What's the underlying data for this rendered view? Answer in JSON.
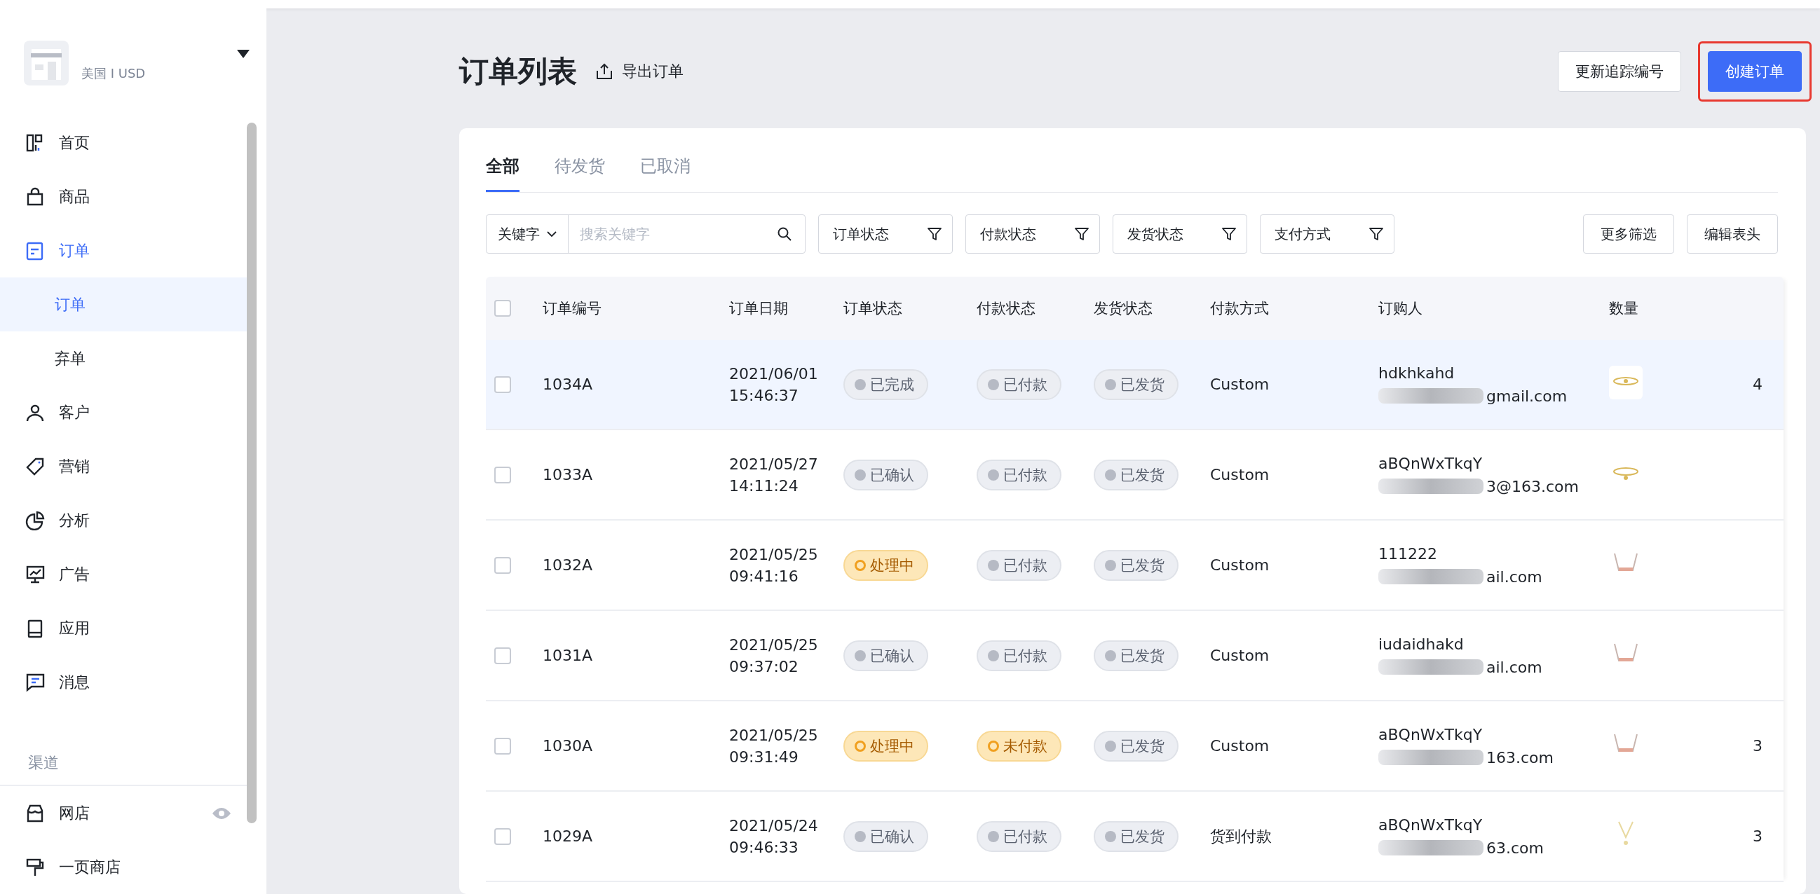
{
  "store": {
    "region": "美国 I USD"
  },
  "sidebar": {
    "items": [
      {
        "label": "首页",
        "selected": false
      },
      {
        "label": "商品",
        "selected": false
      },
      {
        "label": "订单",
        "selected": true,
        "children": [
          {
            "label": "订单",
            "selected": true
          },
          {
            "label": "弃单",
            "selected": false
          }
        ]
      },
      {
        "label": "客户",
        "selected": false
      },
      {
        "label": "营销",
        "selected": false
      },
      {
        "label": "分析",
        "selected": false
      },
      {
        "label": "广告",
        "selected": false
      },
      {
        "label": "应用",
        "selected": false
      },
      {
        "label": "消息",
        "selected": false
      }
    ],
    "section": "渠道",
    "channels": [
      {
        "label": "网店",
        "kind": "visible"
      },
      {
        "label": "一页商店",
        "kind": "plain"
      }
    ]
  },
  "header": {
    "title": "订单列表",
    "export": "导出订单",
    "buttons": [
      {
        "label": "更新追踪编号",
        "kind": "secondary"
      },
      {
        "label": "创建订单",
        "kind": "primary"
      }
    ]
  },
  "tabs": [
    {
      "label": "全部",
      "selected": true
    },
    {
      "label": "待发货",
      "selected": false
    },
    {
      "label": "已取消",
      "selected": false
    }
  ],
  "filters": {
    "keyword_select": "关键字",
    "search": {
      "placeholder": "搜索关键字"
    },
    "dropdowns": [
      "订单状态",
      "付款状态",
      "发货状态",
      "支付方式"
    ],
    "buttons": [
      "更多筛选",
      "编辑表头"
    ]
  },
  "table": {
    "all_checked": false,
    "columns": [
      "订单编号",
      "订单日期",
      "订单状态",
      "付款状态",
      "发货状态",
      "付款方式",
      "订购人",
      "数量"
    ],
    "rows": [
      {
        "selected": true,
        "checked": false,
        "id": "1034A",
        "date": "2021/06/01",
        "time": "15:46:37",
        "order_status": {
          "label": "已完成",
          "kind": "neutral"
        },
        "payment_status": {
          "label": "已付款",
          "kind": "neutral"
        },
        "shipping_status": {
          "label": "已发货",
          "kind": "neutral"
        },
        "method": "Custom",
        "buyer": "hdkhkahd",
        "email": "gmail.com",
        "quantity": "4"
      },
      {
        "selected": false,
        "checked": false,
        "id": "1033A",
        "date": "2021/05/27",
        "time": "14:11:24",
        "order_status": {
          "label": "已确认",
          "kind": "neutral"
        },
        "payment_status": {
          "label": "已付款",
          "kind": "neutral"
        },
        "shipping_status": {
          "label": "已发货",
          "kind": "neutral"
        },
        "method": "Custom",
        "buyer": "aBQnWxTkqY",
        "email": "3@163.com"
      },
      {
        "selected": false,
        "checked": false,
        "id": "1032A",
        "date": "2021/05/25",
        "time": "09:41:16",
        "order_status": {
          "label": "处理中",
          "kind": "warning"
        },
        "payment_status": {
          "label": "已付款",
          "kind": "neutral"
        },
        "shipping_status": {
          "label": "已发货",
          "kind": "neutral"
        },
        "method": "Custom",
        "buyer": "111222",
        "email": "ail.com"
      },
      {
        "selected": false,
        "checked": false,
        "id": "1031A",
        "date": "2021/05/25",
        "time": "09:37:02",
        "order_status": {
          "label": "已确认",
          "kind": "neutral"
        },
        "payment_status": {
          "label": "已付款",
          "kind": "neutral"
        },
        "shipping_status": {
          "label": "已发货",
          "kind": "neutral"
        },
        "method": "Custom",
        "buyer": "iudaidhakd",
        "email": "ail.com"
      },
      {
        "selected": false,
        "checked": false,
        "id": "1030A",
        "date": "2021/05/25",
        "time": "09:31:49",
        "order_status": {
          "label": "处理中",
          "kind": "warning"
        },
        "payment_status": {
          "label": "未付款",
          "kind": "warning"
        },
        "shipping_status": {
          "label": "已发货",
          "kind": "neutral"
        },
        "method": "Custom",
        "buyer": "aBQnWxTkqY",
        "email": "163.com",
        "quantity": "3"
      },
      {
        "selected": false,
        "checked": false,
        "id": "1029A",
        "date": "2021/05/24",
        "time": "09:46:33",
        "order_status": {
          "label": "已确认",
          "kind": "neutral"
        },
        "payment_status": {
          "label": "已付款",
          "kind": "neutral"
        },
        "shipping_status": {
          "label": "已发货",
          "kind": "neutral"
        },
        "method": "货到付款",
        "buyer": "aBQnWxTkqY",
        "email": "63.com",
        "quantity": "3"
      }
    ]
  }
}
